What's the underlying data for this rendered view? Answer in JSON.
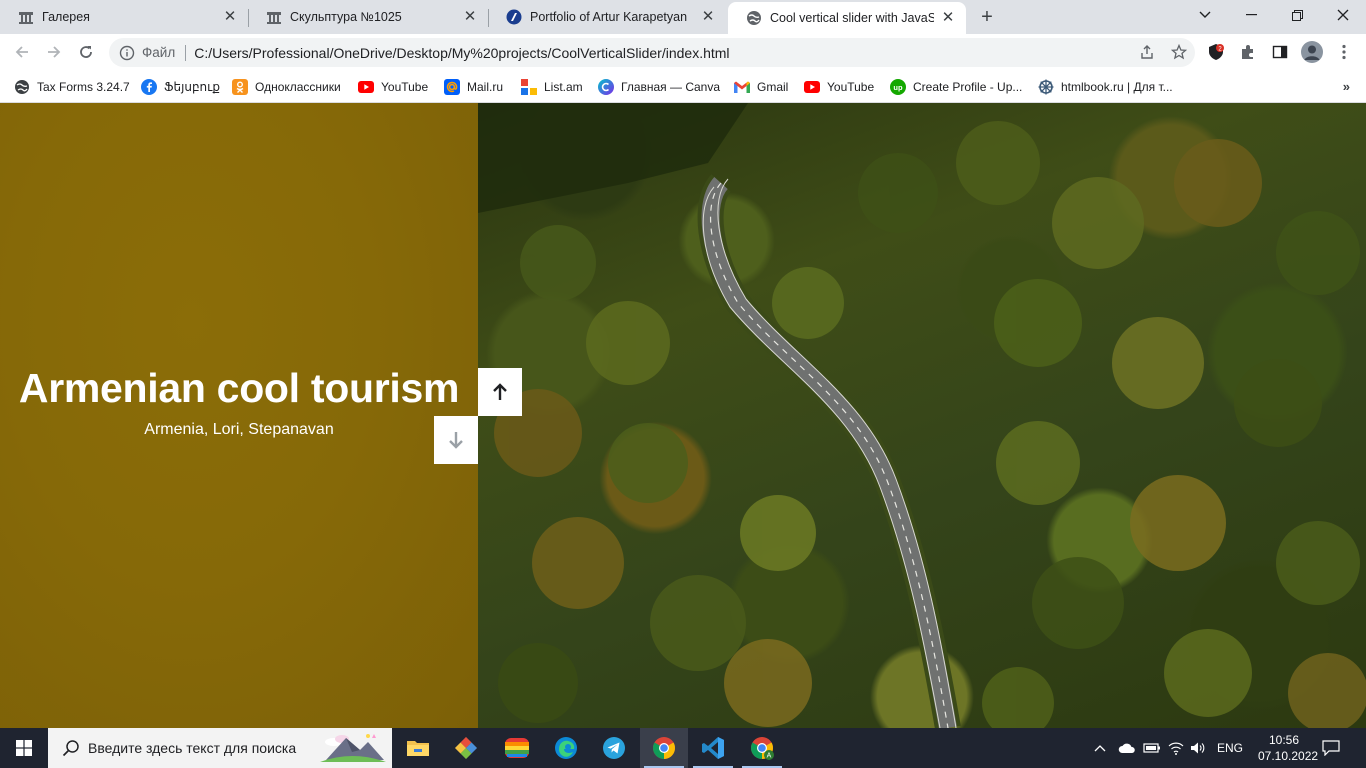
{
  "browser": {
    "tabs": [
      {
        "title": "Галерея",
        "icon": "gallery-favicon"
      },
      {
        "title": "Скульптура №1025",
        "icon": "gallery-favicon"
      },
      {
        "title": "Portfolio of Artur Karapetyan",
        "icon": "portfolio-favicon"
      },
      {
        "title": "Cool vertical slider with JavaScrip",
        "icon": "globe-favicon",
        "active": true
      }
    ],
    "address_bar": {
      "scheme_label": "Файл",
      "url": "C:/Users/Professional/OneDrive/Desktop/My%20projects/CoolVerticalSlider/index.html"
    },
    "bookmarks": [
      {
        "label": "Tax Forms 3.24.7",
        "icon": "globe-icon"
      },
      {
        "label": "Ֆեյսբուք",
        "icon": "facebook-icon"
      },
      {
        "label": "Одноклассники",
        "icon": "odnoklassniki-icon"
      },
      {
        "label": "YouTube",
        "icon": "youtube-icon"
      },
      {
        "label": "Mail.ru",
        "icon": "mailru-icon"
      },
      {
        "label": "List.am",
        "icon": "listam-icon"
      },
      {
        "label": "Главная — Canva",
        "icon": "canva-icon"
      },
      {
        "label": "Gmail",
        "icon": "gmail-icon"
      },
      {
        "label": "YouTube",
        "icon": "youtube-icon"
      },
      {
        "label": "Create Profile - Up...",
        "icon": "upwork-icon"
      },
      {
        "label": "htmlbook.ru | Для т...",
        "icon": "htmlbook-icon"
      }
    ],
    "bookmarks_more": "»",
    "extension_badge": "2"
  },
  "slider": {
    "title": "Armenian cool tourism",
    "subtitle": "Armenia, Lori, Stepanavan",
    "left_color": "#866908",
    "up_button_icon": "arrow-up-icon",
    "down_button_icon": "arrow-down-icon"
  },
  "taskbar": {
    "search_placeholder": "Введите здесь текст для поиска",
    "apps": [
      "file-explorer",
      "git",
      "color-app",
      "edge",
      "telegram",
      "chrome",
      "vscode",
      "chrome-alt"
    ],
    "language": "ENG",
    "time": "10:56",
    "date": "07.10.2022"
  },
  "colors": {
    "tab_strip": "#dee1e6",
    "taskbar": "#1f2430",
    "arrow_active": "#202124",
    "arrow_inactive": "#9aa0a6"
  }
}
